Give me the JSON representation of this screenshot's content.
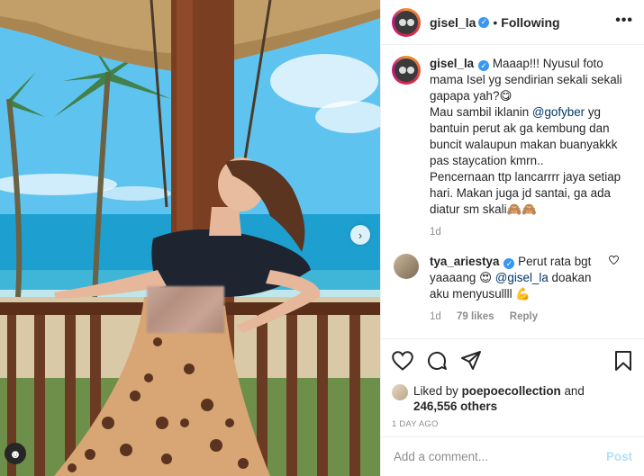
{
  "post": {
    "username": "gisel_la",
    "follow_status": "Following",
    "caption": {
      "line1": "Maaap!!! Nyusul foto mama Isel yg sendirian sekali sekali gapapa yah?😋",
      "line2_pre": "Mau sambil iklanin ",
      "mention": "@gofyber",
      "line2_post": " yg bantuin perut ak ga kembung dan buncit walaupun makan buanyakkk pas staycation kmrn..",
      "line3": "Pencernaan ttp lancarrrr jaya setiap hari. Makan juga jd santai, ga ada diatur sm skali🙈🙈",
      "age": "1d"
    },
    "comment": {
      "username": "tya_ariestya",
      "text_pre": "Perut rata bgt yaaaang 😍 ",
      "mention": "@gisel_la",
      "text_post": " doakan aku menyusullll 💪",
      "age": "1d",
      "likes": "79 likes",
      "reply": "Reply"
    },
    "liked_by": {
      "prefix": "Liked by ",
      "user": "poepoecollection",
      "middle": " and",
      "count": "246,556 others"
    },
    "time_ago": "1 DAY AGO",
    "add_comment_placeholder": "Add a comment...",
    "post_button": "Post"
  },
  "icons": {
    "more": "more-options-icon",
    "next": "chevron-right-icon",
    "like": "heart-icon",
    "comment": "comment-icon",
    "share": "paper-plane-icon",
    "save": "bookmark-icon",
    "verified": "verified-badge-icon",
    "comment_like": "small-heart-icon"
  },
  "colors": {
    "verified": "#3897f0",
    "mention": "#00376b",
    "muted": "#8e8e8e",
    "post_disabled": "#b2dffc"
  }
}
